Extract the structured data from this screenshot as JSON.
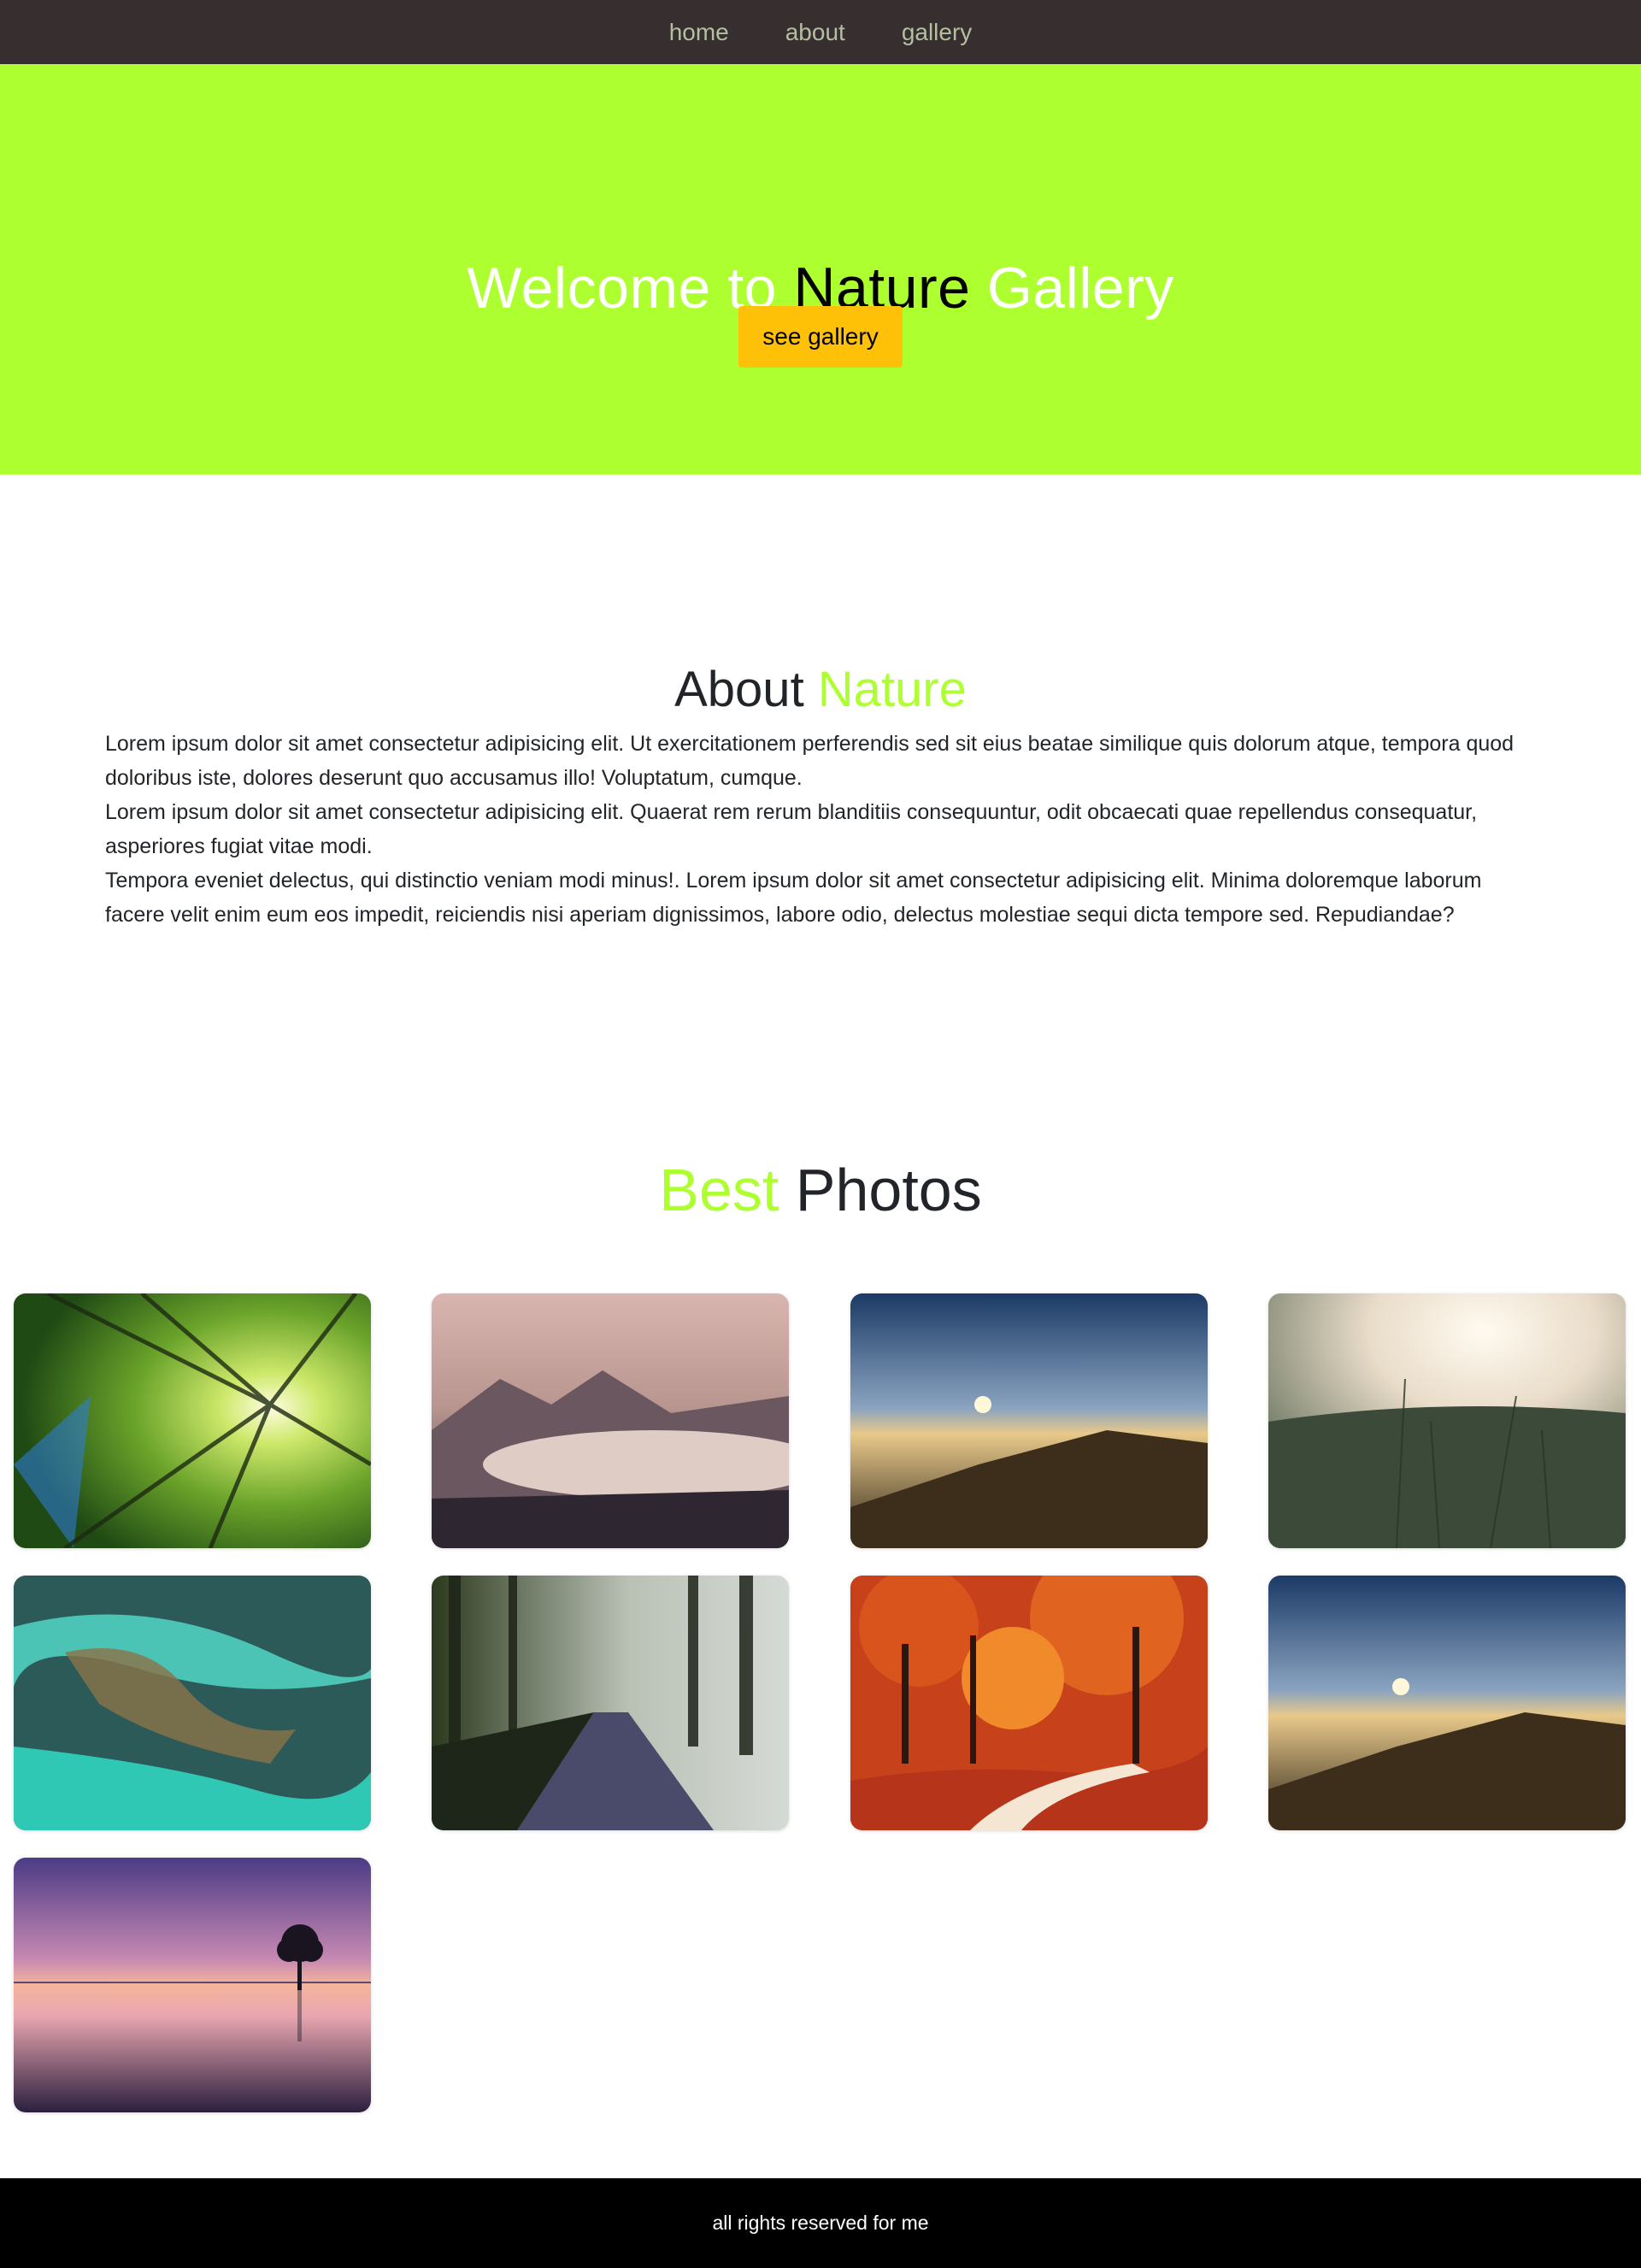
{
  "nav": {
    "items": [
      {
        "label": "home"
      },
      {
        "label": "about"
      },
      {
        "label": "gallery"
      }
    ]
  },
  "hero": {
    "title_part1": "Welcome to ",
    "title_part2": "Nature",
    "title_part3": " Gallery",
    "button_label": "see gallery"
  },
  "about": {
    "title_part1": "About ",
    "title_part2": "Nature",
    "paragraphs": [
      "Lorem ipsum dolor sit amet consectetur adipisicing elit. Ut exercitationem perferendis sed sit eius beatae similique quis dolorum atque, tempora quod doloribus iste, dolores deserunt quo accusamus illo! Voluptatum, cumque.",
      "Lorem ipsum dolor sit amet consectetur adipisicing elit. Quaerat rem rerum blanditiis consequuntur, odit obcaecati quae repellendus consequatur, asperiores fugiat vitae modi.",
      "Tempora eveniet delectus, qui distinctio veniam modi minus!. Lorem ipsum dolor sit amet consectetur adipisicing elit. Minima doloremque laborum facere velit enim eum eos impedit, reiciendis nisi aperiam dignissimos, labore odio, delectus molestiae sequi dicta tempore sed. Repudiandae?"
    ]
  },
  "gallery": {
    "title_part1": "Best",
    "title_part2": " Photos",
    "photos": [
      {
        "subject": "forest-canopy"
      },
      {
        "subject": "misty-mountains"
      },
      {
        "subject": "mountain-sunset"
      },
      {
        "subject": "grass-field"
      },
      {
        "subject": "glacial-river"
      },
      {
        "subject": "forest-road"
      },
      {
        "subject": "autumn-path"
      },
      {
        "subject": "mountain-sunset"
      },
      {
        "subject": "lake-tree-sunset"
      }
    ]
  },
  "footer": {
    "text": "all rights reserved for me"
  },
  "colors": {
    "nav_bg": "#372f2f",
    "nav_link": "#b4bea2",
    "hero_bg": "#adff2f",
    "accent": "#adff2f",
    "button_bg": "#ffc107",
    "footer_bg": "#000000"
  }
}
